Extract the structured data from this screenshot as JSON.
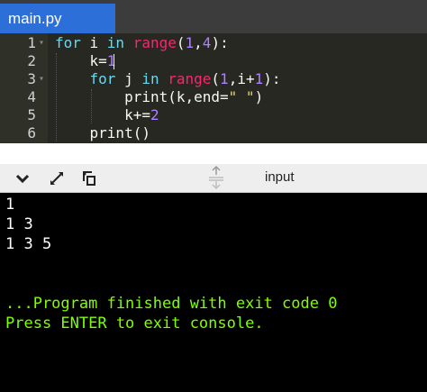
{
  "tab": {
    "label": "main.py"
  },
  "editor": {
    "line_numbers": [
      "1",
      "2",
      "3",
      "4",
      "5",
      "6"
    ],
    "lines": [
      [
        {
          "t": "for ",
          "c": "kw"
        },
        {
          "t": "i ",
          "c": "plain"
        },
        {
          "t": "in ",
          "c": "kw"
        },
        {
          "t": "range",
          "c": "fn"
        },
        {
          "t": "(",
          "c": "plain"
        },
        {
          "t": "1",
          "c": "num"
        },
        {
          "t": ",",
          "c": "plain"
        },
        {
          "t": "4",
          "c": "num"
        },
        {
          "t": "):",
          "c": "plain"
        }
      ],
      [
        {
          "t": "    k=",
          "c": "plain"
        },
        {
          "t": "1",
          "c": "num"
        }
      ],
      [
        {
          "t": "    ",
          "c": "plain"
        },
        {
          "t": "for ",
          "c": "kw"
        },
        {
          "t": "j ",
          "c": "plain"
        },
        {
          "t": "in ",
          "c": "kw"
        },
        {
          "t": "range",
          "c": "fn"
        },
        {
          "t": "(",
          "c": "plain"
        },
        {
          "t": "1",
          "c": "num"
        },
        {
          "t": ",i+",
          "c": "plain"
        },
        {
          "t": "1",
          "c": "num"
        },
        {
          "t": "):",
          "c": "plain"
        }
      ],
      [
        {
          "t": "        print(k,end=",
          "c": "plain"
        },
        {
          "t": "\" \"",
          "c": "str"
        },
        {
          "t": ")",
          "c": "plain"
        }
      ],
      [
        {
          "t": "        k+=",
          "c": "plain"
        },
        {
          "t": "2",
          "c": "num"
        }
      ],
      [
        {
          "t": "    print()",
          "c": "plain"
        }
      ]
    ]
  },
  "toolbar": {
    "input_label": "input"
  },
  "console": {
    "output_lines": [
      "1",
      "1 3",
      "1 3 5"
    ],
    "finished_message": "...Program finished with exit code 0",
    "exit_prompt": "Press ENTER to exit console."
  },
  "colors": {
    "tab_active": "#2d6fd8",
    "editor_bg": "#272822",
    "console_success": "#7fff00"
  }
}
